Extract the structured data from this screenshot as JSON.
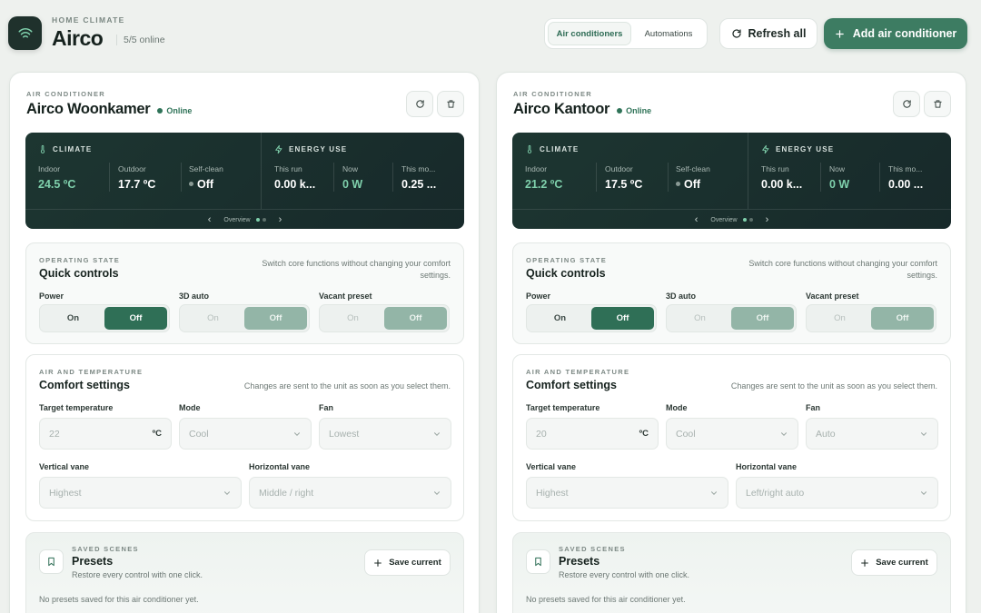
{
  "header": {
    "eyebrow": "HOME CLIMATE",
    "title": "Airco",
    "online": "5/5 online",
    "tabs": [
      {
        "label": "Air conditioners"
      },
      {
        "label": "Automations"
      }
    ],
    "refresh_label": "Refresh all",
    "add_label": "Add air conditioner"
  },
  "cards": [
    {
      "eyebrow": "AIR CONDITIONER",
      "name": "Airco Woonkamer",
      "status": "Online",
      "climate_title": "CLIMATE",
      "energy_title": "ENERGY USE",
      "indoor_label": "Indoor",
      "indoor": "24.5 ºC",
      "outdoor_label": "Outdoor",
      "outdoor": "17.7 ºC",
      "selfclean_label": "Self-clean",
      "selfclean": "Off",
      "run_label": "This run",
      "run": "0.00 k...",
      "now_label": "Now",
      "now": "0 W",
      "month_label": "This mo...",
      "month": "0.25 ...",
      "pager_label": "Overview",
      "ops_eyebrow": "OPERATING STATE",
      "ops_title": "Quick controls",
      "ops_desc_1": "Switch core functions without changing your comfort",
      "ops_desc_2": "settings.",
      "power_label": "Power",
      "auto3d_label": "3D auto",
      "vacant_label": "Vacant preset",
      "on_label": "On",
      "off_label": "Off",
      "comfort_eyebrow": "AIR AND TEMPERATURE",
      "comfort_title": "Comfort settings",
      "comfort_desc": "Changes are sent to the unit as soon as you select them.",
      "target_label": "Target temperature",
      "target": "22",
      "unit": "ºC",
      "mode_label": "Mode",
      "mode": "Cool",
      "fan_label": "Fan",
      "fan": "Lowest",
      "vvane_label": "Vertical vane",
      "vvane": "Highest",
      "hvane_label": "Horizontal vane",
      "hvane": "Middle / right",
      "presets_eyebrow": "SAVED SCENES",
      "presets_title": "Presets",
      "presets_sub": "Restore every control with one click.",
      "save_label": "Save current",
      "presets_empty": "No presets saved for this air conditioner yet."
    },
    {
      "eyebrow": "AIR CONDITIONER",
      "name": "Airco Kantoor",
      "status": "Online",
      "climate_title": "CLIMATE",
      "energy_title": "ENERGY USE",
      "indoor_label": "Indoor",
      "indoor": "21.2 ºC",
      "outdoor_label": "Outdoor",
      "outdoor": "17.5 ºC",
      "selfclean_label": "Self-clean",
      "selfclean": "Off",
      "run_label": "This run",
      "run": "0.00 k...",
      "now_label": "Now",
      "now": "0 W",
      "month_label": "This mo...",
      "month": "0.00 ...",
      "pager_label": "Overview",
      "ops_eyebrow": "OPERATING STATE",
      "ops_title": "Quick controls",
      "ops_desc_1": "Switch core functions without changing your comfort",
      "ops_desc_2": "settings.",
      "power_label": "Power",
      "auto3d_label": "3D auto",
      "vacant_label": "Vacant preset",
      "on_label": "On",
      "off_label": "Off",
      "comfort_eyebrow": "AIR AND TEMPERATURE",
      "comfort_title": "Comfort settings",
      "comfort_desc": "Changes are sent to the unit as soon as you select them.",
      "target_label": "Target temperature",
      "target": "20",
      "unit": "ºC",
      "mode_label": "Mode",
      "mode": "Cool",
      "fan_label": "Fan",
      "fan": "Auto",
      "vvane_label": "Vertical vane",
      "vvane": "Highest",
      "hvane_label": "Horizontal vane",
      "hvane": "Left/right auto",
      "presets_eyebrow": "SAVED SCENES",
      "presets_title": "Presets",
      "presets_sub": "Restore every control with one click.",
      "save_label": "Save current",
      "presets_empty": "No presets saved for this air conditioner yet."
    }
  ],
  "colors": {
    "accent": "#3d7c62",
    "dark_panel": "#1d3631",
    "metric_accent": "#7fd0ac",
    "background": "#eef1ee"
  },
  "icons": [
    "airflow-icon",
    "refresh-icon",
    "plus-icon",
    "trash-icon",
    "thermometer-icon",
    "bolt-icon",
    "bookmark-icon",
    "chevron-down-icon",
    "chevron-left-icon",
    "chevron-right-icon"
  ]
}
